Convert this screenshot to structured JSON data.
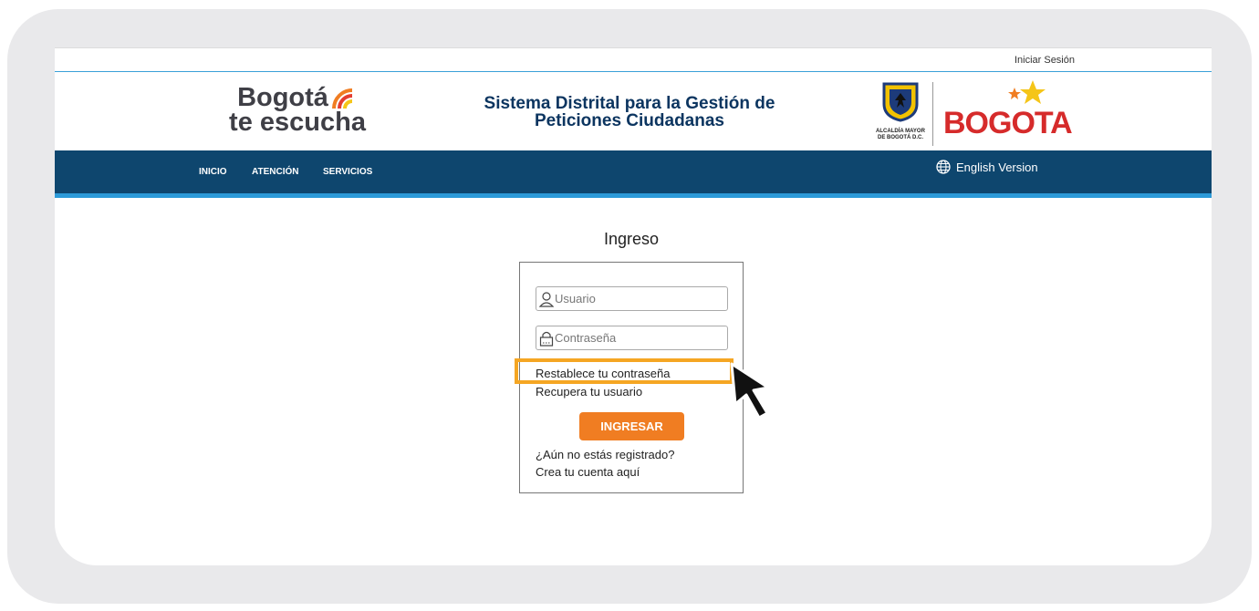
{
  "header": {
    "signin_label": "Iniciar Sesión",
    "logo_line1": "Bogotá",
    "logo_line2": "te escucha",
    "system_title_line1": "Sistema Distrital para la Gestión de",
    "system_title_line2": "Peticiones Ciudadanas",
    "crest_caption_line1": "ALCALDÍA MAYOR",
    "crest_caption_line2": "DE BOGOTÁ D.C.",
    "city_logo_text": "BOGOTA"
  },
  "nav": {
    "items": [
      {
        "label": "INICIO"
      },
      {
        "label": "ATENCIÓN"
      },
      {
        "label": "SERVICIOS"
      }
    ],
    "language_label": "English Version"
  },
  "login": {
    "title": "Ingreso",
    "username_placeholder": "Usuario",
    "password_placeholder": "Contraseña",
    "reset_password_link": "Restablece tu contraseña",
    "recover_user_link": "Recupera tu usuario",
    "submit_label": "INGRESAR",
    "not_registered_link": "¿Aún no estás registrado?",
    "create_account_link": "Crea tu cuenta aquí"
  },
  "colors": {
    "navbar": "#0e466e",
    "accent_blue": "#2c9ad8",
    "button": "#f07d22",
    "highlight": "#f5a623"
  }
}
